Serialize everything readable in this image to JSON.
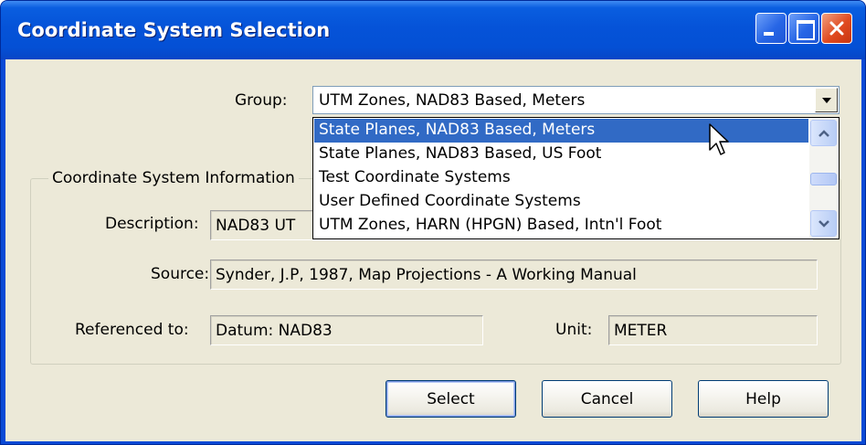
{
  "window": {
    "title": "Coordinate System Selection"
  },
  "group": {
    "label": "Group:",
    "selected_value": "UTM Zones, NAD83 Based, Meters",
    "options_visible": [
      "State Planes, NAD83 Based, Meters",
      "State Planes, NAD83 Based, US Foot",
      "Test Coordinate Systems",
      "User Defined Coordinate Systems",
      "UTM Zones, HARN (HPGN) Based, Intn'l Foot"
    ],
    "highlighted_option": "State Planes, NAD83 Based, Meters"
  },
  "info": {
    "legend": "Coordinate System Information",
    "description_label": "Description:",
    "description_value": "NAD83 UT",
    "source_label": "Source:",
    "source_value": "Synder, J.P, 1987, Map Projections - A Working Manual",
    "referenced_label": "Referenced to:",
    "referenced_value": "Datum: NAD83",
    "unit_label": "Unit:",
    "unit_value": "METER"
  },
  "buttons": {
    "select": "Select",
    "cancel": "Cancel",
    "help": "Help"
  },
  "colors": {
    "titlebar": "#0553d8",
    "selection": "#316ac5",
    "dialog_face": "#ece9d8"
  }
}
